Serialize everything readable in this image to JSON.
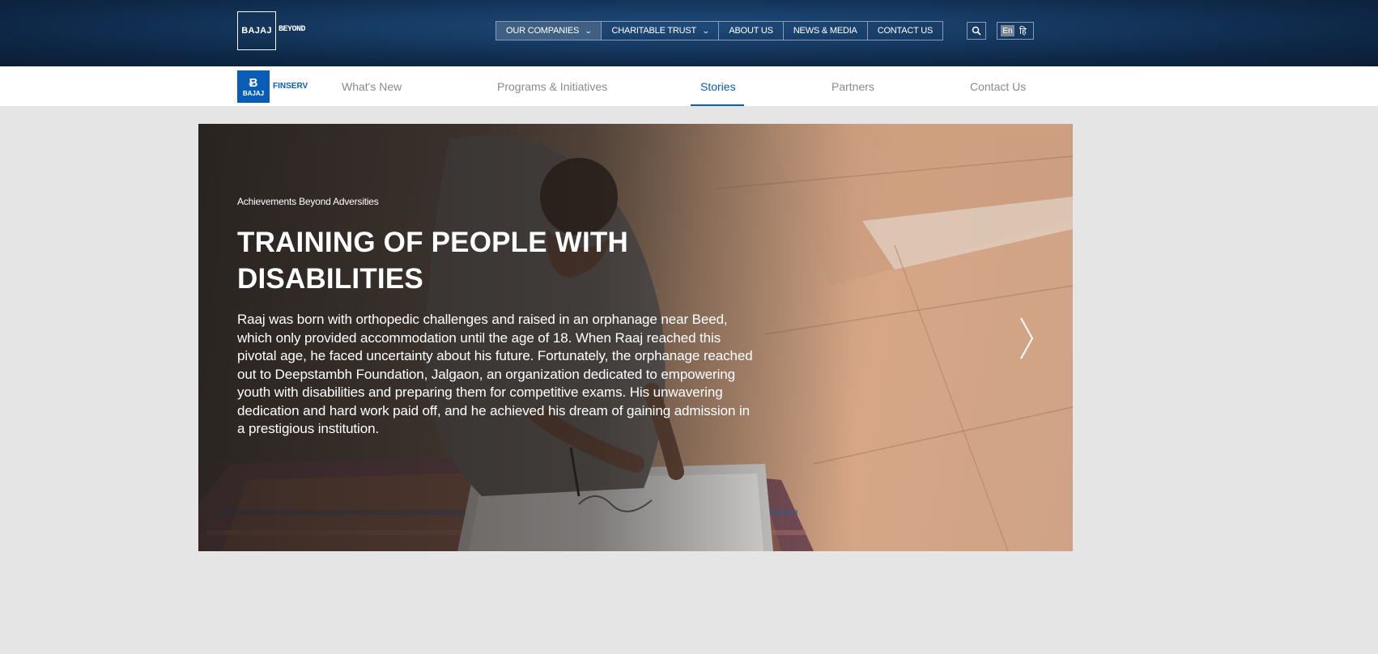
{
  "header": {
    "logo_text": "BAJAJ",
    "logo_suffix": "BEYOND",
    "nav": [
      {
        "label": "OUR COMPANIES",
        "has_dropdown": true,
        "active": true
      },
      {
        "label": "CHARITABLE TRUST",
        "has_dropdown": true,
        "active": false
      },
      {
        "label": "ABOUT US",
        "has_dropdown": false,
        "active": false
      },
      {
        "label": "NEWS & MEDIA",
        "has_dropdown": false,
        "active": false
      },
      {
        "label": "CONTACT US",
        "has_dropdown": false,
        "active": false
      }
    ],
    "search_icon": "search-icon",
    "language": {
      "current": "En",
      "alternate": "हि"
    }
  },
  "subnav": {
    "logo_text": "BAJAJ",
    "logo_suffix": "FINSERV",
    "links": [
      {
        "label": "What's New",
        "active": false
      },
      {
        "label": "Programs & Initiatives",
        "active": false
      },
      {
        "label": "Stories",
        "active": true
      },
      {
        "label": "Partners",
        "active": false
      },
      {
        "label": "Contact Us",
        "active": false
      }
    ],
    "active_color": "#0a5db6"
  },
  "hero": {
    "eyebrow": "Achievements Beyond Adversities",
    "title": "TRAINING OF PEOPLE WITH DISABILITIES",
    "body": "Raaj was born with orthopedic challenges and raised in an orphanage near Beed, which only provided accommodation until the age of 18. When Raaj reached this pivotal age, he faced uncertainty about his future. Fortunately, the orphanage reached out to Deepstambh Foundation, Jalgaon, an organization dedicated to empowering youth with disabilities and preparing them for competitive exams. His unwavering dedication and hard work paid off, and he achieved his dream of gaining admission in a prestigious institution.",
    "next_icon": "chevron-right-icon"
  },
  "colors": {
    "header_bg": "#0e2746",
    "page_bg": "#e5e5e5",
    "brand_blue": "#0a5db6"
  }
}
